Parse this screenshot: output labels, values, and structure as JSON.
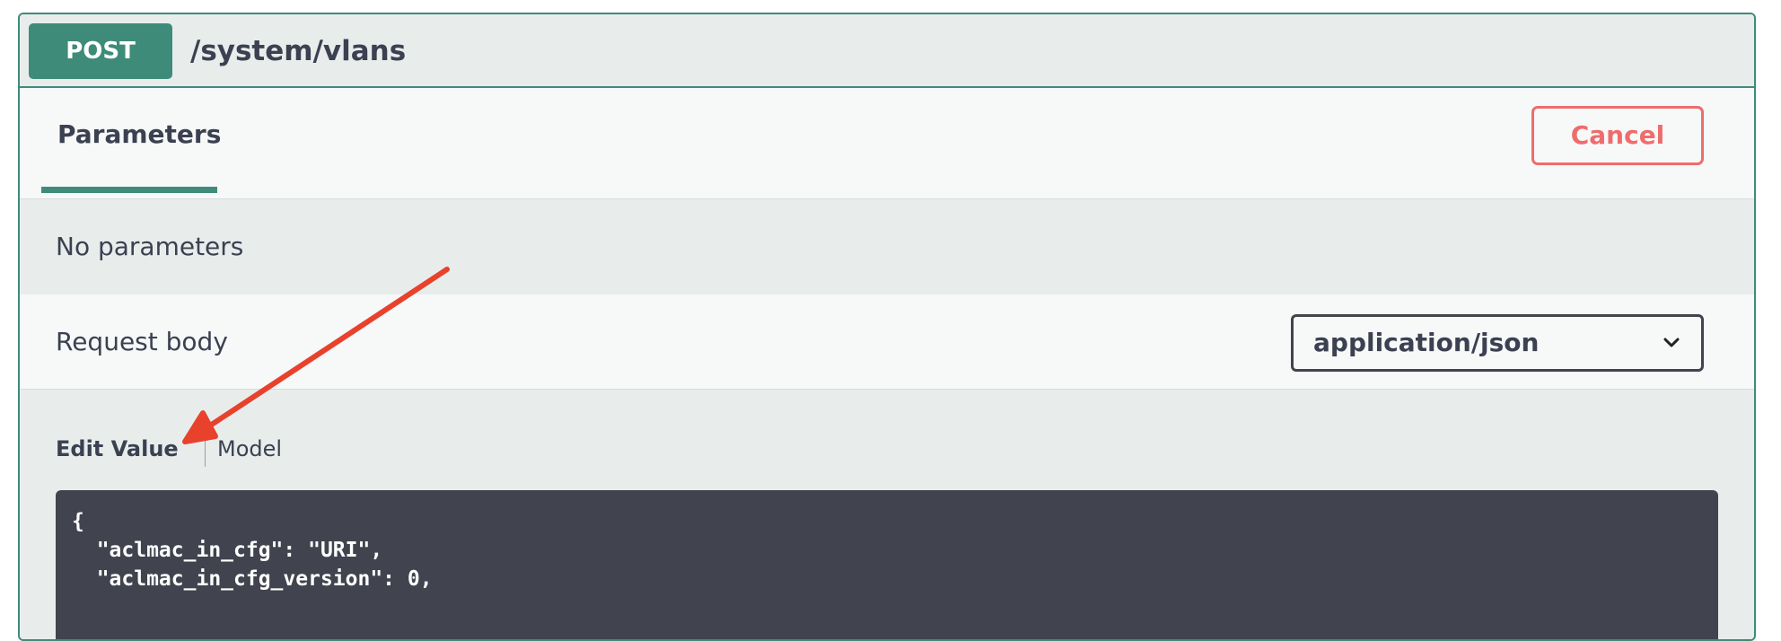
{
  "operation": {
    "method": "POST",
    "path": "/system/vlans"
  },
  "tabs": {
    "parameters_label": "Parameters",
    "cancel_label": "Cancel"
  },
  "parameters": {
    "empty_text": "No parameters"
  },
  "request_body": {
    "label": "Request body",
    "content_type": "application/json"
  },
  "editor": {
    "edit_value_label": "Edit Value",
    "model_label": "Model",
    "code_lines": [
      "{",
      "  \"aclmac_in_cfg\": \"URI\",",
      "  \"aclmac_in_cfg_version\": 0,"
    ]
  },
  "annotation": {
    "arrow_color": "#e8412c"
  },
  "colors": {
    "accent": "#3e8b79",
    "cancel": "#ef6c6c",
    "text": "#3b4151",
    "code_bg": "#41444e"
  }
}
